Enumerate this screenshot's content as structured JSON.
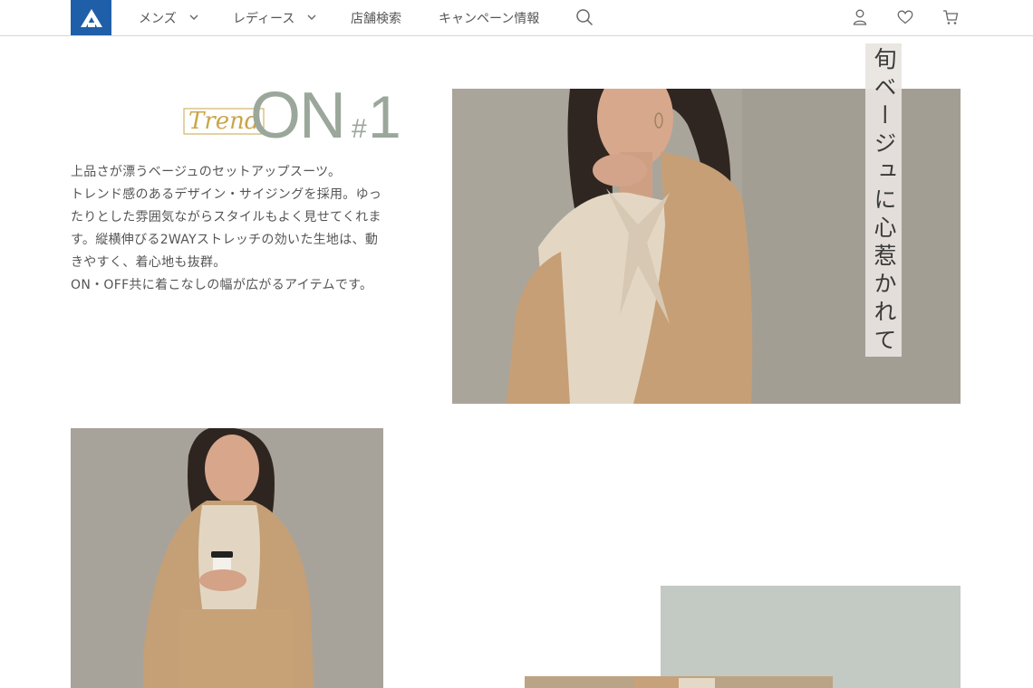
{
  "header": {
    "nav": [
      {
        "label": "メンズ",
        "has_dropdown": true
      },
      {
        "label": "レディース",
        "has_dropdown": true
      },
      {
        "label": "店舗検索",
        "has_dropdown": false
      },
      {
        "label": "キャンペーン情報",
        "has_dropdown": false
      }
    ],
    "icons": [
      "search-icon",
      "user-icon",
      "heart-icon",
      "cart-icon"
    ],
    "brand_color": "#1f5fa9"
  },
  "feature": {
    "tag_script": "Trend",
    "tag_main": "ON",
    "tag_number_prefix": "#",
    "tag_number": "1",
    "tag_colors": {
      "script": "#c9a64a",
      "main": "#9aa79a"
    },
    "description": [
      "上品さが漂うベージュのセットアップスーツ。",
      "トレンド感のあるデザイン・サイジングを採用。ゆったりとした雰囲気ながらスタイルもよく見せてくれます。縦横伸びる2WAYストレッチの効いた生地は、動きやすく、着心地も抜群。",
      "ON・OFF共に着こなしの幅が広がるアイテムです。"
    ],
    "vertical_caption": "旬ベージュに心惹かれて"
  },
  "palette": {
    "accent_block": "#c3c9c3",
    "photo_background": "#aaa59b",
    "jacket": "#c9a27a",
    "blouse": "#e6dccb"
  }
}
